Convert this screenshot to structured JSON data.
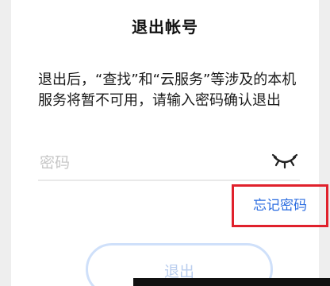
{
  "dialog": {
    "title": "退出帐号",
    "message": "退出后，“查找”和“云服务”等涉及的本机服务将暂不可用，请输入密码确认退出",
    "password": {
      "placeholder": "密码",
      "value": "",
      "visibility_icon": "eye-closed-icon"
    },
    "forgot_password_label": "忘记密码",
    "logout_button_label": "退出"
  },
  "colors": {
    "link": "#2c6de0",
    "highlight_box": "#e0212c",
    "button_border": "#cfe0fa",
    "button_text_disabled": "#b9cdee"
  }
}
